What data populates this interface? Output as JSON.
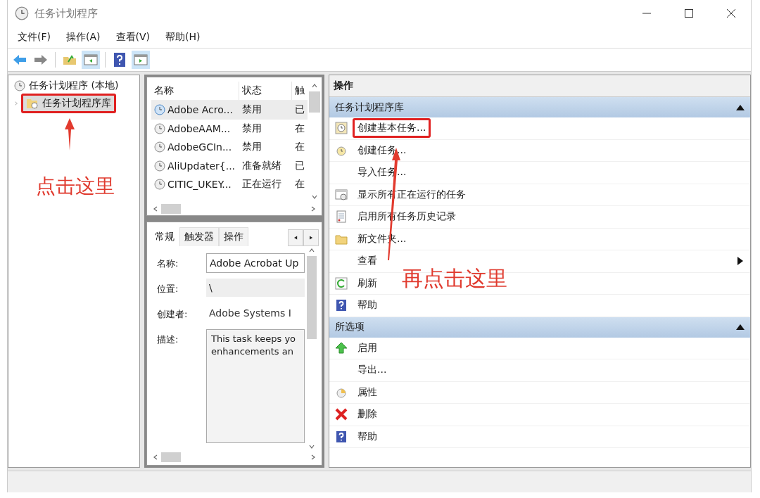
{
  "window": {
    "title": "任务计划程序"
  },
  "menu": [
    {
      "label": "文件(F)"
    },
    {
      "label": "操作(A)"
    },
    {
      "label": "查看(V)"
    },
    {
      "label": "帮助(H)"
    }
  ],
  "toolbar": [
    {
      "kind": "back",
      "pressed": false
    },
    {
      "kind": "forward",
      "pressed": false
    },
    {
      "kind": "up",
      "pressed": false
    },
    {
      "kind": "tree",
      "pressed": true
    },
    {
      "kind": "help",
      "pressed": false
    },
    {
      "kind": "actions",
      "pressed": true
    }
  ],
  "tree": [
    {
      "label": "任务计划程序 (本地)",
      "selected": false,
      "children": [
        {
          "label": "任务计划程序库",
          "selected": true,
          "highlighted": true
        }
      ]
    }
  ],
  "task_list": {
    "columns": [
      "名称",
      "状态",
      "触"
    ],
    "rows": [
      {
        "name": "Adobe Acro...",
        "status": "禁用",
        "column_3": "已",
        "selected": true
      },
      {
        "name": "AdobeAAM...",
        "status": "禁用",
        "column_3": "在",
        "selected": false
      },
      {
        "name": "AdobeGCIn...",
        "status": "禁用",
        "column_3": "在",
        "selected": false
      },
      {
        "name": "AliUpdater{...",
        "status": "准备就绪",
        "column_3": "已",
        "selected": false
      },
      {
        "name": "CITIC_UKEY...",
        "status": "正在运行",
        "column_3": "在",
        "selected": false
      }
    ]
  },
  "details": {
    "tabs": [
      {
        "label": "常规",
        "selected": true
      },
      {
        "label": "触发器",
        "selected": false
      },
      {
        "label": "操作",
        "selected": false
      }
    ],
    "fields": [
      {
        "kind": "input",
        "label": "名称:",
        "value": "Adobe Acrobat Up"
      },
      {
        "kind": "plain",
        "label": "位置:",
        "value": "\\"
      },
      {
        "kind": "text",
        "label": "创建者:",
        "value": "Adobe Systems I"
      },
      {
        "kind": "area",
        "label": "描述:",
        "value": "This task keeps yo\nenhancements an"
      }
    ]
  },
  "actions": {
    "title": "操作",
    "sections": [
      {
        "title": "任务计划程序库",
        "expanded": true,
        "items": [
          {
            "label": "创建基本任务...",
            "submenu": false,
            "highlighted": true
          },
          {
            "label": "创建任务...",
            "submenu": false,
            "highlighted": false
          },
          {
            "label": "导入任务...",
            "submenu": false,
            "highlighted": false
          },
          {
            "label": "显示所有正在运行的任务",
            "submenu": false,
            "highlighted": false
          },
          {
            "label": "启用所有任务历史记录",
            "submenu": false,
            "highlighted": false
          },
          {
            "label": "新文件夹...",
            "submenu": false,
            "highlighted": false
          },
          {
            "label": "查看",
            "submenu": true,
            "highlighted": false
          },
          {
            "label": "刷新",
            "submenu": false,
            "highlighted": false
          },
          {
            "label": "帮助",
            "submenu": false,
            "highlighted": false
          }
        ]
      },
      {
        "title": "所选项",
        "expanded": true,
        "items": [
          {
            "label": "启用",
            "submenu": false,
            "highlighted": false
          },
          {
            "label": "导出...",
            "submenu": false,
            "highlighted": false
          },
          {
            "label": "属性",
            "submenu": false,
            "highlighted": false
          },
          {
            "label": "删除",
            "submenu": false,
            "highlighted": false
          },
          {
            "label": "帮助",
            "submenu": false,
            "highlighted": false
          }
        ]
      }
    ]
  },
  "annotations": [
    {
      "kind": "tree-callout",
      "text": "点击这里"
    },
    {
      "kind": "action-callout",
      "text": "再点击这里"
    }
  ]
}
